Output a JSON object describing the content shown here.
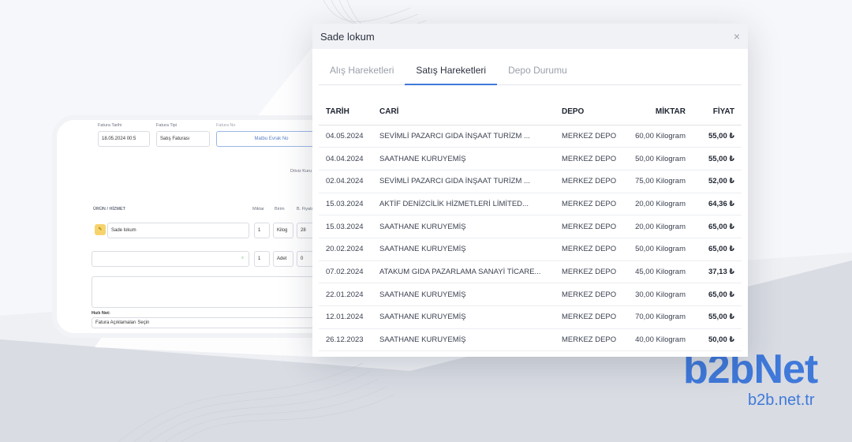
{
  "background_form": {
    "invoice_date_label": "Fatura Tarihi",
    "invoice_date_value": "18.05.2024 00:5",
    "invoice_type_label": "Fatura Tipi",
    "invoice_type_value": "Satış Faturası",
    "invoice_no_label": "Fatura No",
    "invoice_no_value": "Matbu Evrak No",
    "currency_label": "Döviz Kuru",
    "product_col": "ÜRÜN / HİZMET",
    "qty_col": "Miktar",
    "unit_col": "Birim",
    "price_col": "B. Fiyatı",
    "row1_name": "Sade lokum",
    "row1_qty": "1",
    "row1_unit": "Kilog",
    "row1_price": "28",
    "row2_qty": "1",
    "row2_unit": "Adet",
    "row2_price": "0",
    "note_label": "Hızlı Not:",
    "note_placeholder": "Fatura Açıklamaları Seçin"
  },
  "modal": {
    "title": "Sade lokum",
    "close_glyph": "×",
    "tabs": [
      {
        "label": "Alış Hareketleri",
        "active": false
      },
      {
        "label": "Satış Hareketleri",
        "active": true
      },
      {
        "label": "Depo Durumu",
        "active": false
      }
    ],
    "columns": {
      "date": "TARİH",
      "account": "CARİ",
      "warehouse": "DEPO",
      "quantity": "MİKTAR",
      "price": "FİYAT"
    },
    "rows": [
      {
        "date": "04.05.2024",
        "account": "SEVİMLİ PAZARCI GIDA İNŞAAT TURİZM ...",
        "warehouse": "MERKEZ DEPO",
        "quantity": "60,00 Kilogram",
        "price": "55,00 ₺"
      },
      {
        "date": "04.04.2024",
        "account": "SAATHANE KURUYEMİŞ",
        "warehouse": "MERKEZ DEPO",
        "quantity": "50,00 Kilogram",
        "price": "55,00 ₺"
      },
      {
        "date": "02.04.2024",
        "account": "SEVİMLİ PAZARCI GIDA İNŞAAT TURİZM ...",
        "warehouse": "MERKEZ DEPO",
        "quantity": "75,00 Kilogram",
        "price": "52,00 ₺"
      },
      {
        "date": "15.03.2024",
        "account": "AKTİF DENİZCİLİK HİZMETLERİ LİMİTED...",
        "warehouse": "MERKEZ DEPO",
        "quantity": "20,00 Kilogram",
        "price": "64,36 ₺"
      },
      {
        "date": "15.03.2024",
        "account": "SAATHANE KURUYEMİŞ",
        "warehouse": "MERKEZ DEPO",
        "quantity": "20,00 Kilogram",
        "price": "65,00 ₺"
      },
      {
        "date": "20.02.2024",
        "account": "SAATHANE KURUYEMİŞ",
        "warehouse": "MERKEZ DEPO",
        "quantity": "50,00 Kilogram",
        "price": "65,00 ₺"
      },
      {
        "date": "07.02.2024",
        "account": "ATAKUM GIDA PAZARLAMA SANAYİ TİCARE...",
        "warehouse": "MERKEZ DEPO",
        "quantity": "45,00 Kilogram",
        "price": "37,13 ₺"
      },
      {
        "date": "22.01.2024",
        "account": "SAATHANE KURUYEMİŞ",
        "warehouse": "MERKEZ DEPO",
        "quantity": "30,00 Kilogram",
        "price": "65,00 ₺"
      },
      {
        "date": "12.01.2024",
        "account": "SAATHANE KURUYEMİŞ",
        "warehouse": "MERKEZ DEPO",
        "quantity": "70,00 Kilogram",
        "price": "55,00 ₺"
      },
      {
        "date": "26.12.2023",
        "account": "SAATHANE KURUYEMİŞ",
        "warehouse": "MERKEZ DEPO",
        "quantity": "40,00 Kilogram",
        "price": "50,00 ₺"
      }
    ]
  },
  "brand": {
    "logo_text": "b2bNet",
    "url": "b2b.net.tr",
    "color": "#3f79da"
  }
}
